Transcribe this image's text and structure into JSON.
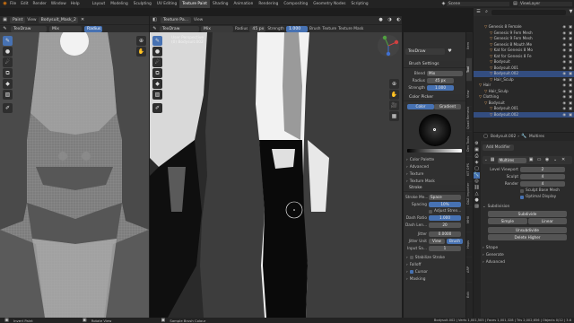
{
  "topbar": {
    "menus": [
      "File",
      "Edit",
      "Render",
      "Window",
      "Help"
    ],
    "workspaces": [
      "Layout",
      "Modeling",
      "Sculpting",
      "UV Editing",
      "Texture Paint",
      "Shading",
      "Animation",
      "Rendering",
      "Compositing",
      "Geometry Nodes",
      "Scripting"
    ],
    "active_workspace": "Texture Paint",
    "scene_label": "Scene",
    "viewlayer_label": "ViewLayer"
  },
  "image_editor": {
    "mode": "Paint",
    "view": "View",
    "image_name": "Bodysuit_Mask_2",
    "brush": "TexDraw",
    "blend": "Mix",
    "radius_label": "Radius"
  },
  "viewport": {
    "mode": "Texture Pa...",
    "view_menu": "View",
    "brush": "TexDraw",
    "blend": "Mix",
    "radius_label": "Radius",
    "radius_value": "45 px",
    "strength_label": "Strength",
    "strength_value": "1.000",
    "brush_menu": "Brush",
    "texture_menu": "Texture",
    "texture_mask_menu": "Texture Mask",
    "overlay_title": "User Perspective",
    "overlay_object": "(0) Bodysuit.002"
  },
  "brush_panel": {
    "brush_name": "TexDraw",
    "settings_title": "Brush Settings",
    "blend_label": "Blend",
    "blend_value": "Mix",
    "radius_label": "Radius",
    "radius_value": "45 px",
    "strength_label": "Strength",
    "strength_value": "1.000",
    "color_picker_title": "Color Picker",
    "color_tab": "Color",
    "gradient_tab": "Gradient",
    "sections": [
      "Color Palette",
      "Advanced",
      "Texture",
      "Texture Mask"
    ],
    "stroke_title": "Stroke",
    "stroke_method_label": "Stroke Me...",
    "stroke_method_value": "Space",
    "spacing_label": "Spacing",
    "spacing_value": "10%",
    "adjust_strength_label": "Adjust Stren...",
    "dash_ratio_label": "Dash Ratio",
    "dash_ratio_value": "1.000",
    "dash_length_label": "Dash Len...",
    "dash_length_value": "20",
    "jitter_label": "Jitter",
    "jitter_value": "0.0000",
    "jitter_unit_label": "Jitter Unit",
    "jitter_unit_view": "View",
    "jitter_unit_brush": "Brush",
    "input_samples_label": "Input Sa...",
    "input_samples_value": "1",
    "stabilize_label": "Stabilize Stroke",
    "falloff_label": "Falloff",
    "cursor_label": "Cursor",
    "masking_label": "Masking"
  },
  "side_tabs": [
    "Item",
    "Tool",
    "View",
    "Quad Remesh",
    "Dev Tools",
    "KIT OPS",
    "DAZ Importer",
    "MHX",
    "Hops",
    "ARP",
    "Edit"
  ],
  "outliner": {
    "rows": [
      {
        "name": "Genesis 8 Female",
        "indent": 4
      },
      {
        "name": "Genesis 9 Fem Mesh",
        "indent": 6
      },
      {
        "name": "Genesis 9 Fem Mesh",
        "indent": 6
      },
      {
        "name": "Genesis 8 Mouth Me",
        "indent": 6
      },
      {
        "name": "Kat for Genesis 8 Mo",
        "indent": 6
      },
      {
        "name": "Kat for Genesis 8 Fe",
        "indent": 6
      },
      {
        "name": "Bodysuit",
        "indent": 6
      },
      {
        "name": "Bodysuit.001",
        "indent": 6
      },
      {
        "name": "Bodysuit.002",
        "indent": 6,
        "selected": true
      },
      {
        "name": "Hair_Sculp",
        "indent": 6
      },
      {
        "name": "Hair",
        "indent": 2
      },
      {
        "name": "Hair_Sculp",
        "indent": 4
      },
      {
        "name": "Clothing",
        "indent": 2
      },
      {
        "name": "Bodysuit",
        "indent": 4
      },
      {
        "name": "Bodysuit.001",
        "indent": 6
      },
      {
        "name": "Bodysuit.002",
        "indent": 6,
        "selected": true
      }
    ]
  },
  "properties": {
    "object_name": "Bodysuit.002",
    "modifier_tab": "Multires",
    "add_modifier": "Add Modifier",
    "modifier_name": "Multires",
    "level_viewport_label": "Level Viewport",
    "level_viewport_value": "2",
    "sculpt_label": "Sculpt",
    "sculpt_value": "4",
    "render_label": "Render",
    "render_value": "4",
    "sculpt_base_mesh": "Sculpt Base Mesh",
    "optimal_display": "Optimal Display",
    "subdivision_title": "Subdivision",
    "subdivide_btn": "Subdivide",
    "simple_btn": "Simple",
    "linear_btn": "Linear",
    "unsubdivide_btn": "Unsubdivide",
    "delete_higher_btn": "Delete Higher",
    "shape_section": "Shape",
    "generate_section": "Generate",
    "advanced_section": "Advanced"
  },
  "statusbar": {
    "left": "Invert Paint",
    "middle1": "Rotate View",
    "middle2": "Sample Brush Colour",
    "right": "Bodysuit.002 | Verts 1,001,505 | Faces 1,001,328 | Tris 2,002,656 | Objects 0/12 | 3.6"
  },
  "colors": {
    "accent": "#4772b3",
    "selection": "#334d80",
    "panel_bg": "#303030",
    "header_bg": "#262626"
  }
}
